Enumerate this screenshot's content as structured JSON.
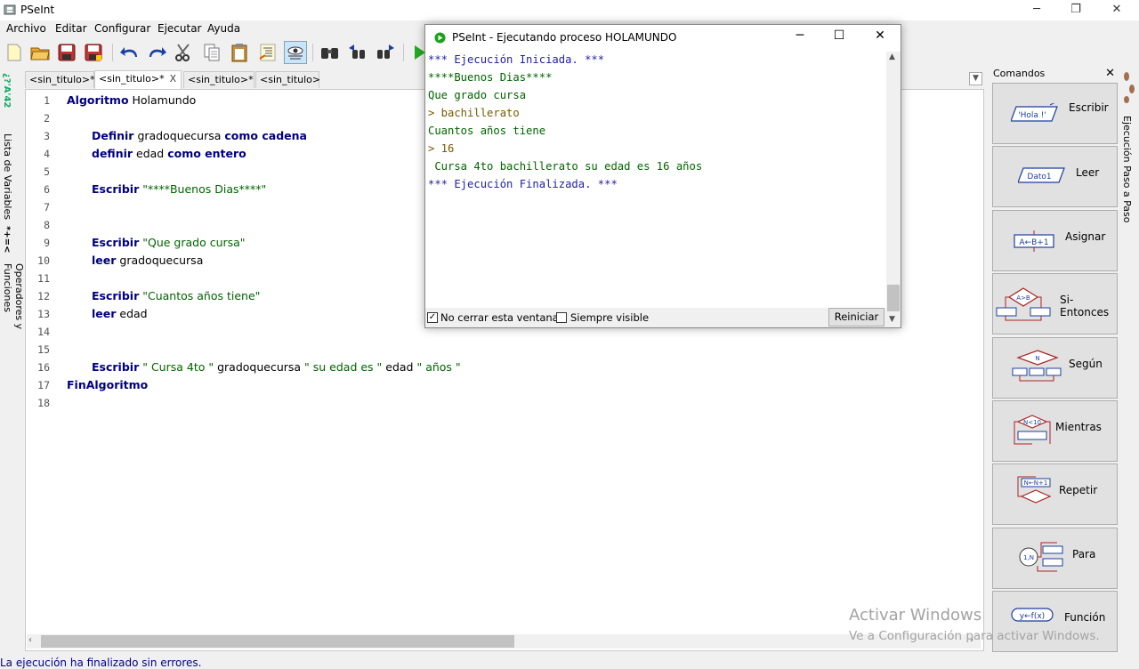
{
  "window": {
    "title": "PSeInt"
  },
  "menu": [
    "Archivo",
    "Editar",
    "Configurar",
    "Ejecutar",
    "Ayuda"
  ],
  "left_tabs": {
    "variables": "Lista de Variables",
    "operators": "Operadores y Funciones",
    "variables_icon_text": "*+=<",
    "operators_icon_text": "¿?'A'42"
  },
  "tabs": [
    {
      "label": "<sin_titulo>*"
    },
    {
      "label": "<sin_titulo>*",
      "close": "X"
    },
    {
      "label": "<sin_titulo>*"
    },
    {
      "label": "<sin_titulo>"
    }
  ],
  "editor": {
    "lines": [
      {
        "n": "1",
        "parts": [
          [
            "kw",
            "Algoritmo"
          ],
          [
            "idf",
            " Holamundo"
          ]
        ],
        "indent": 0
      },
      {
        "n": "2",
        "parts": [],
        "indent": 0
      },
      {
        "n": "3",
        "parts": [
          [
            "kw",
            "Definir"
          ],
          [
            "idf",
            " gradoquecursa "
          ],
          [
            "kw",
            "como cadena"
          ]
        ],
        "indent": 1
      },
      {
        "n": "4",
        "parts": [
          [
            "kw",
            "definir"
          ],
          [
            "idf",
            " edad "
          ],
          [
            "kw",
            "como entero"
          ]
        ],
        "indent": 1
      },
      {
        "n": "5",
        "parts": [],
        "indent": 0
      },
      {
        "n": "6",
        "parts": [
          [
            "kw",
            "Escribir"
          ],
          [
            "idf",
            " "
          ],
          [
            "str",
            "\"****Buenos Dias****\""
          ]
        ],
        "indent": 1
      },
      {
        "n": "7",
        "parts": [],
        "indent": 0
      },
      {
        "n": "8",
        "parts": [],
        "indent": 0
      },
      {
        "n": "9",
        "parts": [
          [
            "kw",
            "Escribir"
          ],
          [
            "idf",
            " "
          ],
          [
            "str",
            "\"Que grado cursa\""
          ]
        ],
        "indent": 1
      },
      {
        "n": "10",
        "parts": [
          [
            "kw",
            "leer"
          ],
          [
            "idf",
            " gradoquecursa"
          ]
        ],
        "indent": 1
      },
      {
        "n": "11",
        "parts": [],
        "indent": 0
      },
      {
        "n": "12",
        "parts": [
          [
            "kw",
            "Escribir"
          ],
          [
            "idf",
            " "
          ],
          [
            "str",
            "\"Cuantos años tiene\""
          ]
        ],
        "indent": 1
      },
      {
        "n": "13",
        "parts": [
          [
            "kw",
            "leer"
          ],
          [
            "idf",
            " edad"
          ]
        ],
        "indent": 1
      },
      {
        "n": "14",
        "parts": [],
        "indent": 0
      },
      {
        "n": "15",
        "parts": [],
        "indent": 0
      },
      {
        "n": "16",
        "parts": [
          [
            "kw",
            "Escribir"
          ],
          [
            "idf",
            " "
          ],
          [
            "str",
            "\" Cursa 4to \""
          ],
          [
            "idf",
            " gradoquecursa "
          ],
          [
            "str",
            "\" su edad es \""
          ],
          [
            "idf",
            " edad "
          ],
          [
            "str",
            "\" años \""
          ]
        ],
        "indent": 1
      },
      {
        "n": "17",
        "parts": [
          [
            "kw",
            "FinAlgoritmo"
          ]
        ],
        "indent": 0
      },
      {
        "n": "18",
        "parts": [],
        "indent": 0
      }
    ]
  },
  "status": "La ejecución ha finalizado sin errores.",
  "commands": {
    "header": "Comandos",
    "close": "✕",
    "items": [
      {
        "label": "Escribir",
        "icon_text": "'Hola !'"
      },
      {
        "label": "Leer",
        "icon_text": "Dato1"
      },
      {
        "label": "Asignar",
        "icon_text": "A←B+1"
      },
      {
        "label": "Si-Entonces",
        "icon_text": "A>B"
      },
      {
        "label": "Según",
        "icon_text": "N"
      },
      {
        "label": "Mientras",
        "icon_text": "N<10"
      },
      {
        "label": "Repetir",
        "icon_text": "N←N+1"
      },
      {
        "label": "Para",
        "icon_text": "1,N"
      },
      {
        "label": "Función",
        "icon_text": "y←f(x)"
      }
    ]
  },
  "right_tab": "Ejecución Paso a Paso",
  "exec_window": {
    "title": "PSeInt - Ejecutando proceso HOLAMUNDO",
    "lines": [
      {
        "text": "*** Ejecución Iniciada. ***",
        "color": "#1f1fa0"
      },
      {
        "text": "****Buenos Dias****",
        "color": "#006400"
      },
      {
        "text": "Que grado cursa",
        "color": "#006400"
      },
      {
        "text": "> bachillerato",
        "color": "#7a5a00"
      },
      {
        "text": "Cuantos años tiene",
        "color": "#006400"
      },
      {
        "text": "> 16",
        "color": "#7a5a00"
      },
      {
        "text": " Cursa 4to bachillerato su edad es 16 años",
        "color": "#006400"
      },
      {
        "text": "*** Ejecución Finalizada. ***",
        "color": "#1f1fa0"
      }
    ],
    "no_cerrar": "No cerrar esta ventana",
    "no_cerrar_checked": true,
    "siempre_visible": "Siempre visible",
    "siempre_visible_checked": false,
    "reiniciar": "Reiniciar"
  },
  "watermark": {
    "line1": "Activar Windows",
    "line2": "Ve a Configuración para activar Windows."
  }
}
